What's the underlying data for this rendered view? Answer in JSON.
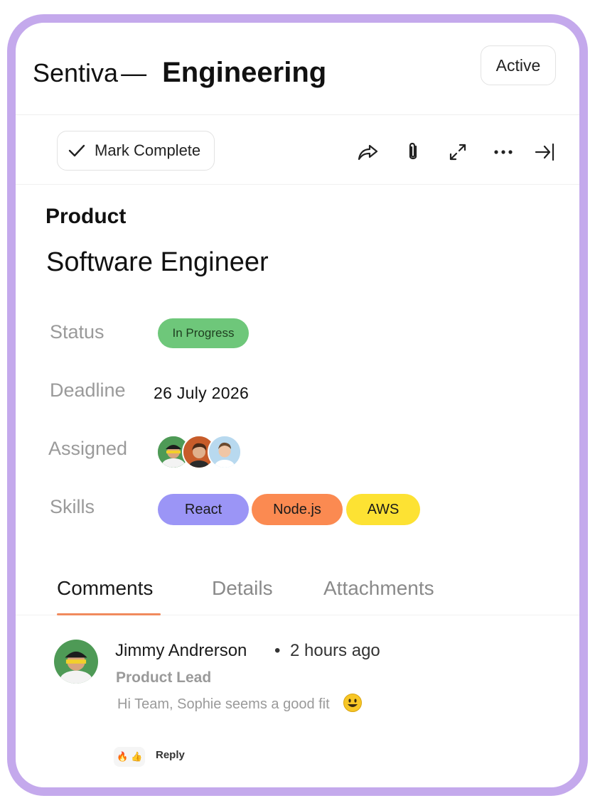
{
  "header": {
    "company": "Sentiva",
    "separator": "—",
    "department": "Engineering",
    "status_button": "Active"
  },
  "toolbar": {
    "mark_complete_label": "Mark Complete",
    "icons": [
      "share-icon",
      "paperclip-icon",
      "expand-icon",
      "more-icon",
      "collapse-panel-icon"
    ]
  },
  "task": {
    "section": "Product",
    "title": "Software Engineer",
    "fields": {
      "status_label": "Status",
      "status_value": "In Progress",
      "deadline_label": "Deadline",
      "deadline_value": "26 July 2026",
      "assigned_label": "Assigned",
      "skills_label": "Skills"
    },
    "skills": [
      {
        "label": "React",
        "color": "#9b95f6"
      },
      {
        "label": "Node.js",
        "color": "#fb8a51"
      },
      {
        "label": "AWS",
        "color": "#fde233"
      }
    ],
    "status_color": "#6ec77a"
  },
  "tabs": [
    {
      "label": "Comments",
      "active": true
    },
    {
      "label": "Details",
      "active": false
    },
    {
      "label": "Attachments",
      "active": false
    }
  ],
  "comment": {
    "author": "Jimmy Andrerson",
    "bullet": "•",
    "time": "2 hours ago",
    "role": "Product Lead",
    "text": "Hi Team, Sophie seems a good fit",
    "reactions": [
      "🔥",
      "👍"
    ],
    "reply_label": "Reply"
  },
  "colors": {
    "frame_border": "#c4a9ec",
    "tab_accent": "#f08a5d"
  }
}
